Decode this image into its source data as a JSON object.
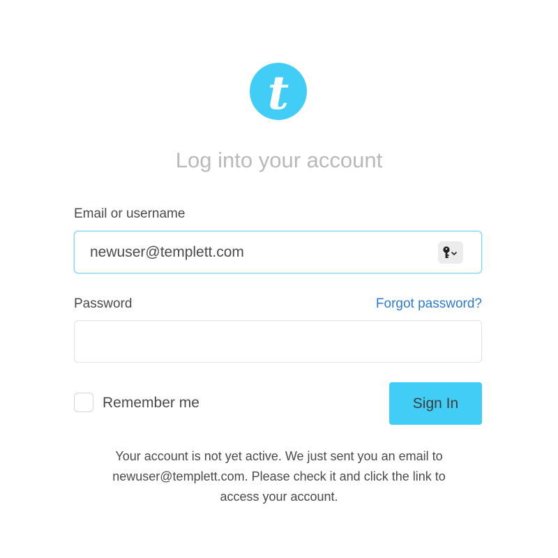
{
  "brand": {
    "logo_letter": "t",
    "color": "#41cdf5"
  },
  "title": "Log into your account",
  "form": {
    "email_label": "Email or username",
    "email_value": "newuser@templett.com",
    "password_label": "Password",
    "password_value": "",
    "forgot_link": "Forgot password?",
    "remember_label": "Remember me",
    "remember_checked": false,
    "signin_label": "Sign In",
    "key_icon": "key-icon"
  },
  "notice": {
    "lines": [
      "Your account is not yet active. We just sent you an email to",
      "newuser@templett.com. Please check it and click the link to",
      "access your account."
    ]
  },
  "colors": {
    "accent": "#41cdf5",
    "link": "#2b7bd1",
    "focus_border": "#7fd6f1",
    "title_text": "#b9b9b9"
  }
}
